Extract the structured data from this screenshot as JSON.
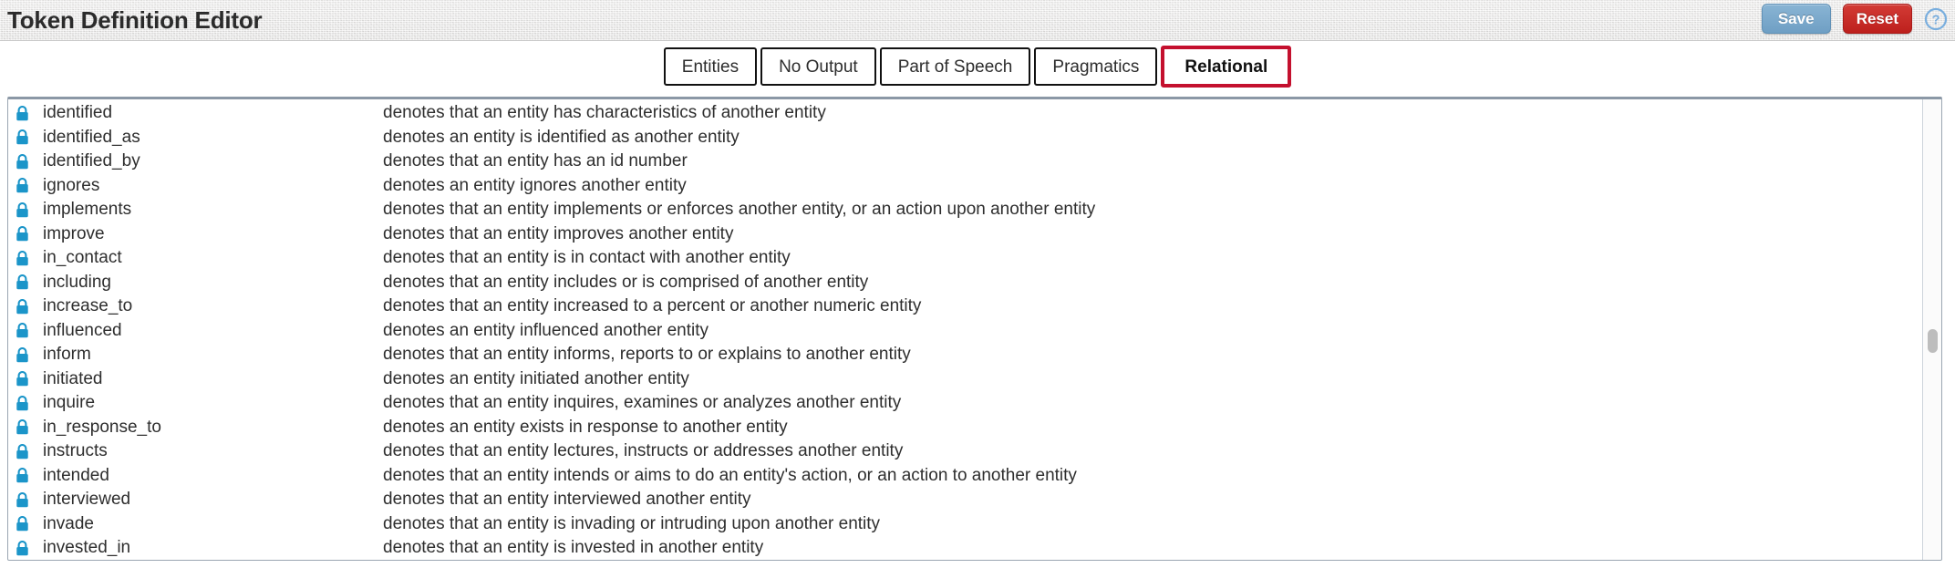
{
  "header": {
    "title": "Token Definition Editor",
    "save_label": "Save",
    "reset_label": "Reset",
    "help_icon": "question-circle-icon",
    "save_color": "#7AA7CA",
    "reset_color": "#C62B26"
  },
  "tabs": [
    {
      "label": "Entities",
      "active": false
    },
    {
      "label": "No Output",
      "active": false
    },
    {
      "label": "Part of Speech",
      "active": false
    },
    {
      "label": "Pragmatics",
      "active": false
    },
    {
      "label": "Relational",
      "active": true
    }
  ],
  "active_tab_border_color": "#C4102E",
  "list": {
    "lock_icon": "lock-icon",
    "lock_color": "#1B95C9",
    "rows": [
      {
        "name": "identified",
        "desc": "denotes that an entity has characteristics of another entity"
      },
      {
        "name": "identified_as",
        "desc": "denotes an entity is identified as another entity"
      },
      {
        "name": "identified_by",
        "desc": "denotes that an entity has an id number"
      },
      {
        "name": "ignores",
        "desc": "denotes an entity ignores another entity"
      },
      {
        "name": "implements",
        "desc": "denotes that an entity implements or enforces another entity, or an action upon another entity"
      },
      {
        "name": "improve",
        "desc": "denotes that an entity improves another entity"
      },
      {
        "name": "in_contact",
        "desc": "denotes that an entity is in contact with another entity"
      },
      {
        "name": "including",
        "desc": "denotes that an entity includes or is comprised of another entity"
      },
      {
        "name": "increase_to",
        "desc": "denotes that an entity increased to a percent or another numeric entity"
      },
      {
        "name": "influenced",
        "desc": "denotes an entity influenced another entity"
      },
      {
        "name": "inform",
        "desc": "denotes that an entity informs, reports to or explains to another entity"
      },
      {
        "name": "initiated",
        "desc": "denotes an entity initiated another entity"
      },
      {
        "name": "inquire",
        "desc": "denotes that an entity inquires, examines or analyzes another entity"
      },
      {
        "name": "in_response_to",
        "desc": "denotes an entity exists in response to another entity"
      },
      {
        "name": "instructs",
        "desc": "denotes that an entity lectures, instructs or addresses another entity"
      },
      {
        "name": "intended",
        "desc": "denotes that an entity intends or aims to do an entity's action, or an action to another entity"
      },
      {
        "name": "interviewed",
        "desc": "denotes that an entity interviewed another entity"
      },
      {
        "name": "invade",
        "desc": "denotes that an entity is invading or intruding upon another entity"
      },
      {
        "name": "invested_in",
        "desc": "denotes that an entity is invested in another entity"
      }
    ]
  }
}
